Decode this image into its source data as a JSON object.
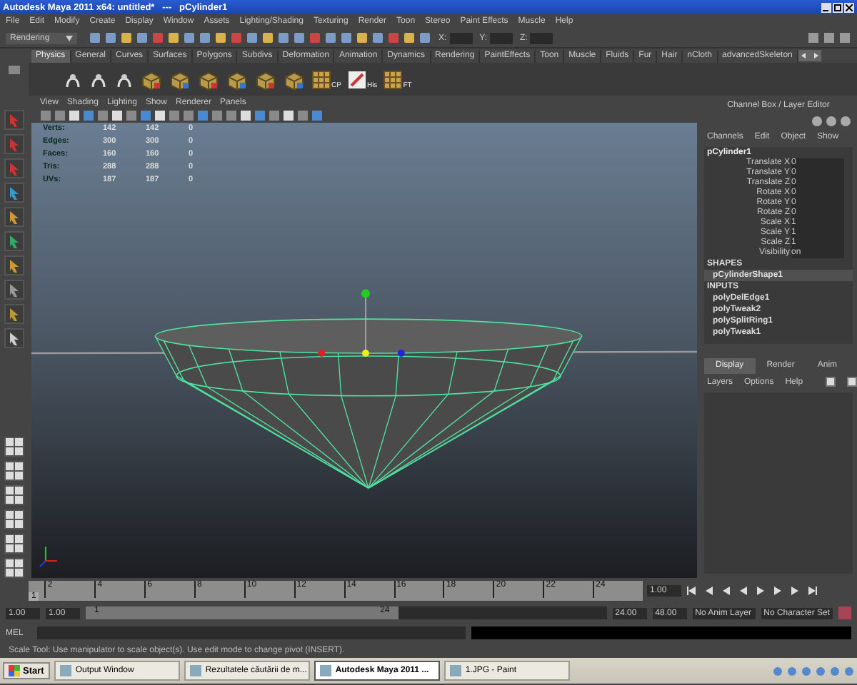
{
  "window": {
    "title": "Autodesk Maya 2011 x64: untitled*   ---   pCylinder1"
  },
  "menu_bar": [
    "File",
    "Edit",
    "Modify",
    "Create",
    "Display",
    "Window",
    "Assets",
    "Lighting/Shading",
    "Texturing",
    "Render",
    "Toon",
    "Stereo",
    "Paint Effects",
    "Muscle",
    "Help"
  ],
  "status_line": {
    "menu_set": "Rendering",
    "coord_labels": [
      "X:",
      "Y:",
      "Z:"
    ]
  },
  "shelf": {
    "tabs": [
      {
        "label": "Physics",
        "selected": true
      },
      {
        "label": "General",
        "selected": false
      },
      {
        "label": "Curves",
        "selected": false
      },
      {
        "label": "Surfaces",
        "selected": false
      },
      {
        "label": "Polygons",
        "selected": false
      },
      {
        "label": "Subdivs",
        "selected": false
      },
      {
        "label": "Deformation",
        "selected": false
      },
      {
        "label": "Animation",
        "selected": false
      },
      {
        "label": "Dynamics",
        "selected": false
      },
      {
        "label": "Rendering",
        "selected": false
      },
      {
        "label": "PaintEffects",
        "selected": false
      },
      {
        "label": "Toon",
        "selected": false
      },
      {
        "label": "Muscle",
        "selected": false
      },
      {
        "label": "Fluids",
        "selected": false
      },
      {
        "label": "Fur",
        "selected": false
      },
      {
        "label": "Hair",
        "selected": false
      },
      {
        "label": "nCloth",
        "selected": false
      },
      {
        "label": "advancedSkeleton",
        "selected": false
      }
    ],
    "buttons": [
      {
        "kind": "plain"
      },
      {
        "kind": "plain"
      },
      {
        "kind": "plain"
      },
      {
        "kind": "cube"
      },
      {
        "kind": "cube"
      },
      {
        "kind": "cube"
      },
      {
        "kind": "cube"
      },
      {
        "kind": "cube"
      },
      {
        "kind": "cube"
      },
      {
        "kind": "grid",
        "label": "CP"
      },
      {
        "kind": "sheet",
        "label": "His"
      },
      {
        "kind": "grid",
        "label": "FT"
      }
    ]
  },
  "viewport": {
    "menu": [
      "View",
      "Shading",
      "Lighting",
      "Show",
      "Renderer",
      "Panels"
    ],
    "stats": [
      {
        "label": "Verts:",
        "values": [
          "142",
          "142",
          "0"
        ]
      },
      {
        "label": "Edges:",
        "values": [
          "300",
          "300",
          "0"
        ]
      },
      {
        "label": "Faces:",
        "values": [
          "160",
          "160",
          "0"
        ]
      },
      {
        "label": "Tris:",
        "values": [
          "288",
          "288",
          "0"
        ]
      },
      {
        "label": "UVs:",
        "values": [
          "187",
          "187",
          "0"
        ]
      }
    ]
  },
  "channel_box": {
    "title": "Channel Box / Layer Editor",
    "menu": [
      "Channels",
      "Edit",
      "Object",
      "Show"
    ],
    "object": "pCylinder1",
    "attributes": [
      {
        "name": "Translate X",
        "value": "0"
      },
      {
        "name": "Translate Y",
        "value": "0"
      },
      {
        "name": "Translate Z",
        "value": "0"
      },
      {
        "name": "Rotate X",
        "value": "0"
      },
      {
        "name": "Rotate Y",
        "value": "0"
      },
      {
        "name": "Rotate Z",
        "value": "0"
      },
      {
        "name": "Scale X",
        "value": "1"
      },
      {
        "name": "Scale Y",
        "value": "1"
      },
      {
        "name": "Scale Z",
        "value": "1"
      },
      {
        "name": "Visibility",
        "value": "on"
      }
    ],
    "shapes_heading": "SHAPES",
    "shapes": [
      "pCylinderShape1"
    ],
    "inputs_heading": "INPUTS",
    "inputs": [
      "polyDelEdge1",
      "polyTweak2",
      "polySplitRing1",
      "polyTweak1"
    ]
  },
  "layer_editor": {
    "tabs": [
      {
        "label": "Display",
        "selected": true
      },
      {
        "label": "Render",
        "selected": false
      },
      {
        "label": "Anim",
        "selected": false
      }
    ],
    "menu": [
      "Layers",
      "Options",
      "Help"
    ]
  },
  "time_slider": {
    "current_frame": "1",
    "frame_labels": [
      "2",
      "4",
      "6",
      "8",
      "10",
      "12",
      "14",
      "16",
      "18",
      "20",
      "22",
      "24"
    ],
    "current_time": "1.00"
  },
  "range_slider": {
    "start": "1.00",
    "playback_start": "1.00",
    "range_start": "1",
    "range_end": "24",
    "playback_end": "24.00",
    "end": "48.00",
    "anim_layer": "No Anim Layer",
    "character_set": "No Character Set"
  },
  "command_line": {
    "label": "MEL"
  },
  "help_line": "Scale Tool: Use manipulator to scale object(s). Use edit mode to change pivot (INSERT).",
  "taskbar": {
    "start": "Start",
    "items": [
      {
        "label": "Output Window",
        "selected": false
      },
      {
        "label": "Rezultatele căutării de m...",
        "selected": false
      },
      {
        "label": "Autodesk Maya 2011 ...",
        "selected": true
      },
      {
        "label": "1.JPG - Paint",
        "selected": false
      }
    ]
  }
}
